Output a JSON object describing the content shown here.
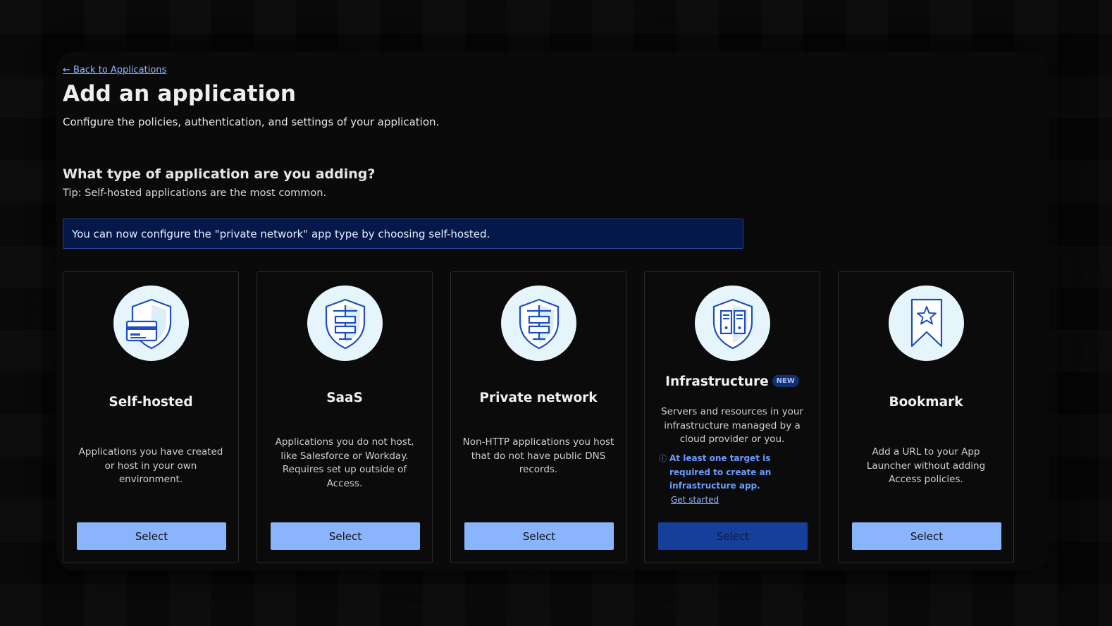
{
  "header": {
    "back_link": "← Back to Applications",
    "title": "Add an application",
    "subtitle": "Configure the policies, authentication, and settings of your application."
  },
  "section": {
    "heading": "What type of application are you adding?",
    "tip": "Tip: Self-hosted applications are the most common."
  },
  "banner": {
    "text": "You can now configure the \"private network\" app type by choosing self-hosted."
  },
  "cards": [
    {
      "title": "Self-hosted",
      "icon": "shield-card-icon",
      "description": "Applications you have created or host in your own environment.",
      "button": "Select",
      "button_disabled": false
    },
    {
      "title": "SaaS",
      "icon": "shield-network-icon",
      "description": "Applications you do not host, like Salesforce or Workday. Requires set up outside of Access.",
      "button": "Select",
      "button_disabled": false
    },
    {
      "title": "Private network",
      "icon": "shield-network-icon",
      "description": "Non-HTTP applications you host that do not have public DNS records.",
      "button": "Select",
      "button_disabled": false
    },
    {
      "title": "Infrastructure",
      "badge": "NEW",
      "icon": "shield-servers-icon",
      "description": "Servers and resources in your infrastructure managed by a cloud provider or you.",
      "note": "At least one target is required to create an infrastructure app.",
      "note_link": "Get started",
      "button": "Select",
      "button_disabled": true
    },
    {
      "title": "Bookmark",
      "icon": "bookmark-star-icon",
      "description": "Add a URL to your App Launcher without adding Access policies.",
      "button": "Select",
      "button_disabled": false
    }
  ],
  "colors": {
    "accent": "#8ab4fb",
    "disabled_button": "#163f9c",
    "banner_bg": "#04184a",
    "link": "#8fb5ff",
    "icon_blue": "#1d4fbf",
    "icon_circle": "#e6f4fc"
  }
}
